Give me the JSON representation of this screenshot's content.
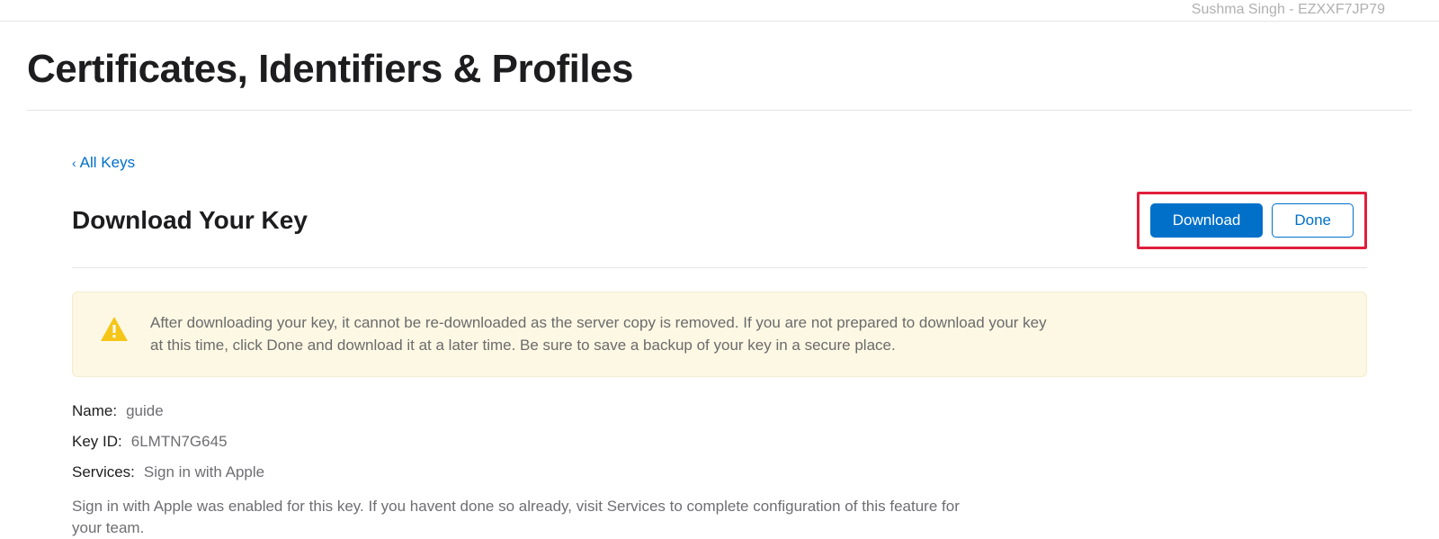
{
  "header": {
    "account_info": "Sushma Singh - EZXXF7JP79"
  },
  "page": {
    "main_title": "Certificates, Identifiers & Profiles",
    "back_link": "All Keys",
    "sub_title": "Download Your Key",
    "download_button": "Download",
    "done_button": "Done"
  },
  "alert": {
    "text": "After downloading your key, it cannot be re-downloaded as the server copy is removed. If you are not prepared to download your key at this time, click Done and download it at a later time. Be sure to save a backup of your key in a secure place."
  },
  "details": {
    "name_label": "Name:",
    "name_value": "guide",
    "keyid_label": "Key ID:",
    "keyid_value": "6LMTN7G645",
    "services_label": "Services:",
    "services_value": "Sign in with Apple",
    "config_note": "Sign in with Apple was enabled for this key. If you havent done so already, visit Services to complete configuration of this feature for your team."
  }
}
